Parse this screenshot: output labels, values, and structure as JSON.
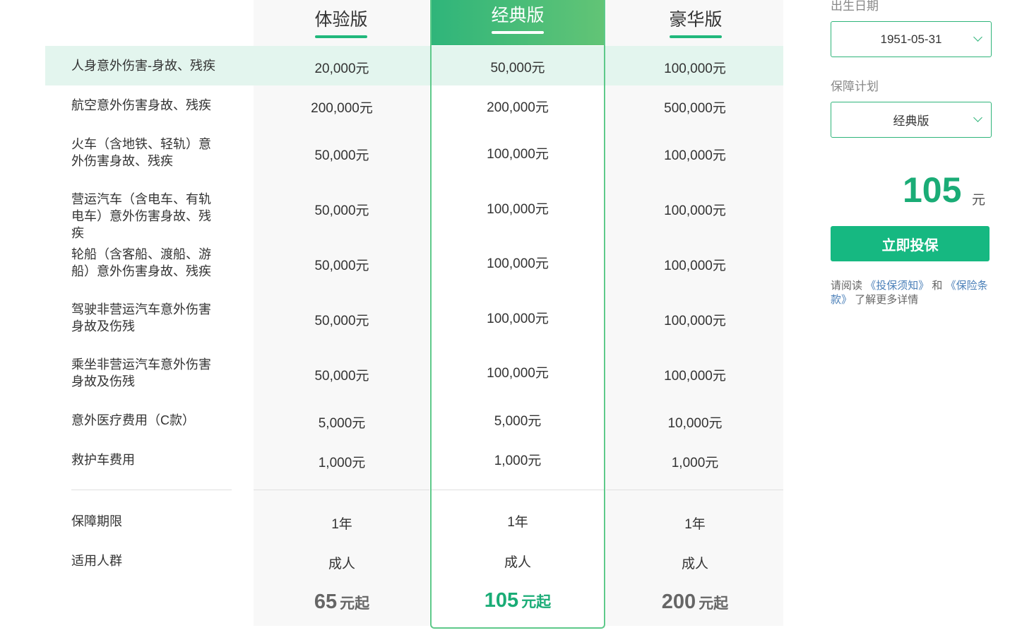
{
  "plans": [
    {
      "title": "体验版",
      "price": "65",
      "price_unit": "元起"
    },
    {
      "title": "经典版",
      "price": "105",
      "price_unit": "元起"
    },
    {
      "title": "豪华版",
      "price": "200",
      "price_unit": "元起"
    }
  ],
  "rows": [
    {
      "label": "人身意外伤害-身故、残疾",
      "values": [
        "20,000元",
        "50,000元",
        "100,000元"
      ]
    },
    {
      "label": "航空意外伤害身故、残疾",
      "values": [
        "200,000元",
        "200,000元",
        "500,000元"
      ]
    },
    {
      "label": "火车（含地铁、轻轨）意外伤害身故、残疾",
      "values": [
        "50,000元",
        "100,000元",
        "100,000元"
      ]
    },
    {
      "label": "营运汽车（含电车、有轨电车）意外伤害身故、残疾",
      "values": [
        "50,000元",
        "100,000元",
        "100,000元"
      ]
    },
    {
      "label": "轮船（含客船、渡船、游船）意外伤害身故、残疾",
      "values": [
        "50,000元",
        "100,000元",
        "100,000元"
      ]
    },
    {
      "label": "驾驶非营运汽车意外伤害身故及伤残",
      "values": [
        "50,000元",
        "100,000元",
        "100,000元"
      ]
    },
    {
      "label": "乘坐非营运汽车意外伤害身故及伤残",
      "values": [
        "50,000元",
        "100,000元",
        "100,000元"
      ]
    },
    {
      "label": "意外医疗费用（C款）",
      "values": [
        "5,000元",
        "5,000元",
        "10,000元"
      ]
    },
    {
      "label": "救护车费用",
      "values": [
        "1,000元",
        "1,000元",
        "1,000元"
      ]
    }
  ],
  "extra_rows": [
    {
      "label": "保障期限",
      "values": [
        "1年",
        "1年",
        "1年"
      ]
    },
    {
      "label": "适用人群",
      "values": [
        "成人",
        "成人",
        "成人"
      ]
    }
  ],
  "sidebar": {
    "birth_label": "出生日期",
    "birth_value": "1951-05-31",
    "plan_label": "保障计划",
    "plan_value": "经典版",
    "price": "105",
    "price_unit": "元",
    "buy_label": "立即投保",
    "notice_pre": "请阅读",
    "notice_link1": "《投保须知》",
    "notice_mid": "和",
    "notice_link2": "《保险条款》",
    "notice_post": "了解更多详情"
  },
  "colors": {
    "accent": "#1aac76",
    "highlight_row": "#e3f5ee",
    "link": "#4a7fb8"
  }
}
